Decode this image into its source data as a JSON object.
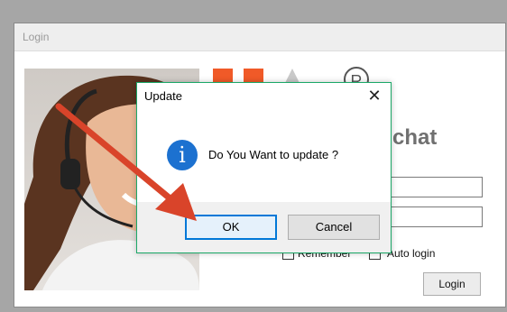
{
  "login_window": {
    "title": "Login",
    "brand_name": "chat",
    "registered_symbol": "R",
    "remember_label": "Remember",
    "auto_login_label": "Auto login",
    "login_button": "Login"
  },
  "dialog": {
    "title": "Update",
    "close_symbol": "✕",
    "info_glyph": "i",
    "message": "Do You Want to update ?",
    "ok_label": "OK",
    "cancel_label": "Cancel"
  },
  "colors": {
    "dialog_border": "#1ba868",
    "info_icon": "#1c71d0",
    "default_button_border": "#0078d7",
    "brand_orange": "#f05a28",
    "annotation_arrow": "#d9442a"
  },
  "icons": [
    "close-icon",
    "info-icon",
    "registered-icon"
  ]
}
